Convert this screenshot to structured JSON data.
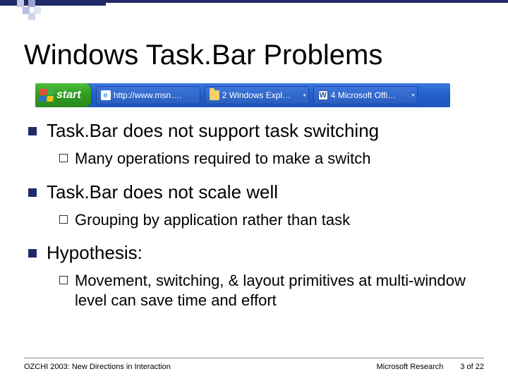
{
  "title": "Windows Task.Bar Problems",
  "taskbar": {
    "start_label": "start",
    "items": [
      {
        "icon": "ie",
        "label": "http://www.msn…."
      },
      {
        "icon": "folder",
        "label": "2 Windows Expl…"
      },
      {
        "icon": "word",
        "label": "4 Microsoft Offi…"
      }
    ]
  },
  "bullets": [
    {
      "text": "Task.Bar does not support task switching",
      "sub": [
        {
          "lead": "Many",
          "rest": " operations required to make a switch"
        }
      ]
    },
    {
      "text": "Task.Bar does not scale well",
      "sub": [
        {
          "lead": "Grouping",
          "rest": " by application rather than task"
        }
      ]
    },
    {
      "text": "Hypothesis:",
      "sub": [
        {
          "lead": "Movement,",
          "rest": " switching, & layout primitives at multi-window level can save time and effort"
        }
      ]
    }
  ],
  "footer": {
    "left": "OZCHI 2003: New Directions in Interaction",
    "center": "Microsoft Research",
    "right": "3 of 22"
  }
}
